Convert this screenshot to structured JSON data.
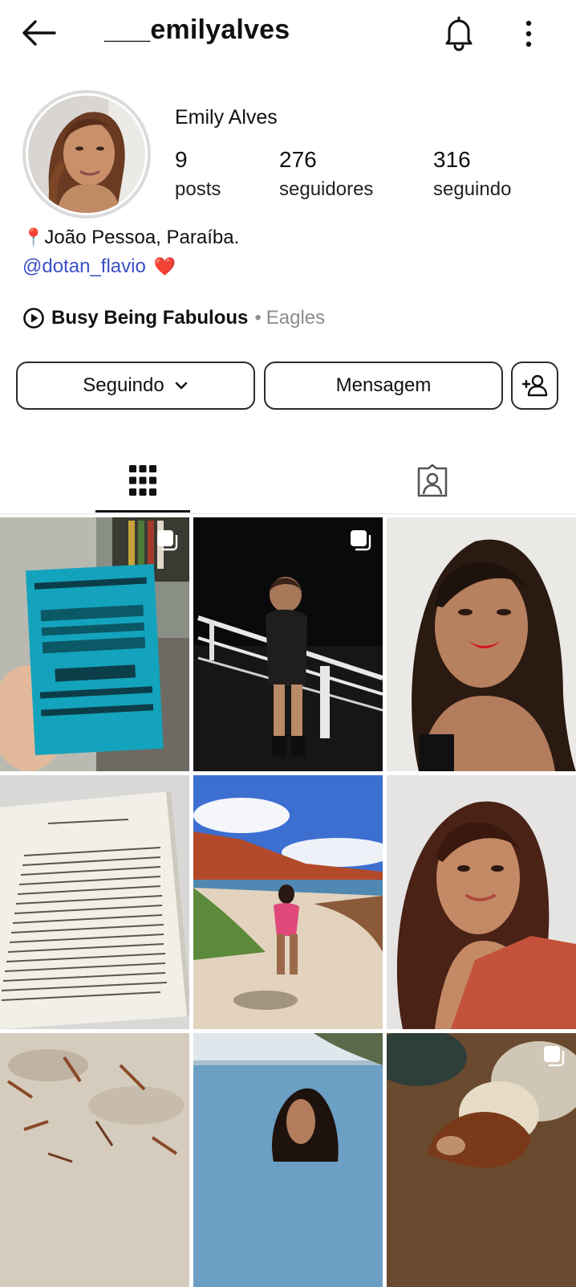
{
  "header": {
    "username": "___emilyalves",
    "back_icon": "arrow-left-icon",
    "bell_icon": "bell-icon",
    "more_icon": "more-vertical-icon"
  },
  "profile": {
    "display_name": "Emily Alves",
    "stats": [
      {
        "value": "9",
        "label": "posts"
      },
      {
        "value": "276",
        "label": "seguidores"
      },
      {
        "value": "316",
        "label": "seguindo"
      }
    ],
    "bio": {
      "location_emoji": "📍",
      "location": "João Pessoa, Paraíba.",
      "mention": "@dotan_flavio",
      "mention_emoji": "❤️"
    },
    "music": {
      "title": "Busy Being Fabulous",
      "separator": "•",
      "artist": "Eagles"
    }
  },
  "actions": {
    "following_label": "Seguindo",
    "message_label": "Mensagem"
  },
  "tabs": [
    {
      "icon": "grid-icon",
      "active": true
    },
    {
      "icon": "tagged-person-icon",
      "active": false
    }
  ],
  "colors": {
    "link": "#3b4fc7",
    "muted": "#8e8e8e",
    "text": "#111111"
  }
}
